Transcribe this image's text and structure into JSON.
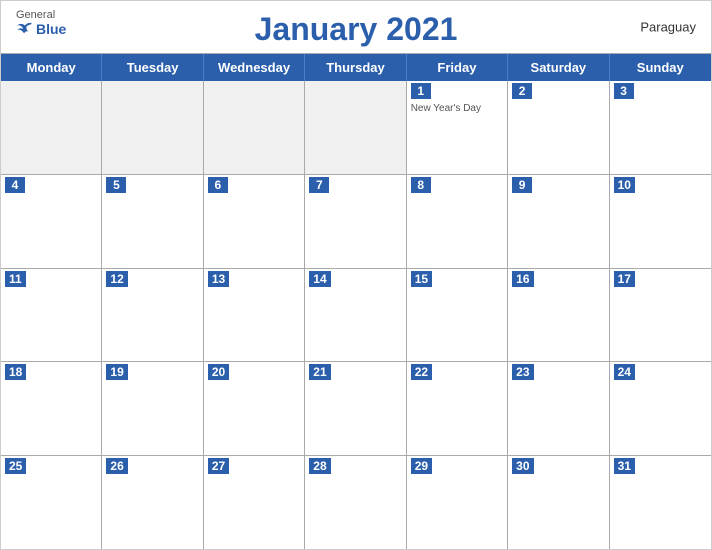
{
  "header": {
    "title": "January 2021",
    "country": "Paraguay",
    "logo": {
      "general": "General",
      "blue": "Blue"
    }
  },
  "dayHeaders": [
    "Monday",
    "Tuesday",
    "Wednesday",
    "Thursday",
    "Friday",
    "Saturday",
    "Sunday"
  ],
  "weeks": [
    [
      {
        "number": "",
        "empty": true
      },
      {
        "number": "",
        "empty": true
      },
      {
        "number": "",
        "empty": true
      },
      {
        "number": "",
        "empty": true
      },
      {
        "number": "1",
        "event": "New Year's Day"
      },
      {
        "number": "2"
      },
      {
        "number": "3"
      }
    ],
    [
      {
        "number": "4"
      },
      {
        "number": "5"
      },
      {
        "number": "6"
      },
      {
        "number": "7"
      },
      {
        "number": "8"
      },
      {
        "number": "9"
      },
      {
        "number": "10"
      }
    ],
    [
      {
        "number": "11"
      },
      {
        "number": "12"
      },
      {
        "number": "13"
      },
      {
        "number": "14"
      },
      {
        "number": "15"
      },
      {
        "number": "16"
      },
      {
        "number": "17"
      }
    ],
    [
      {
        "number": "18"
      },
      {
        "number": "19"
      },
      {
        "number": "20"
      },
      {
        "number": "21"
      },
      {
        "number": "22"
      },
      {
        "number": "23"
      },
      {
        "number": "24"
      }
    ],
    [
      {
        "number": "25"
      },
      {
        "number": "26"
      },
      {
        "number": "27"
      },
      {
        "number": "28"
      },
      {
        "number": "29"
      },
      {
        "number": "30"
      },
      {
        "number": "31"
      }
    ]
  ]
}
